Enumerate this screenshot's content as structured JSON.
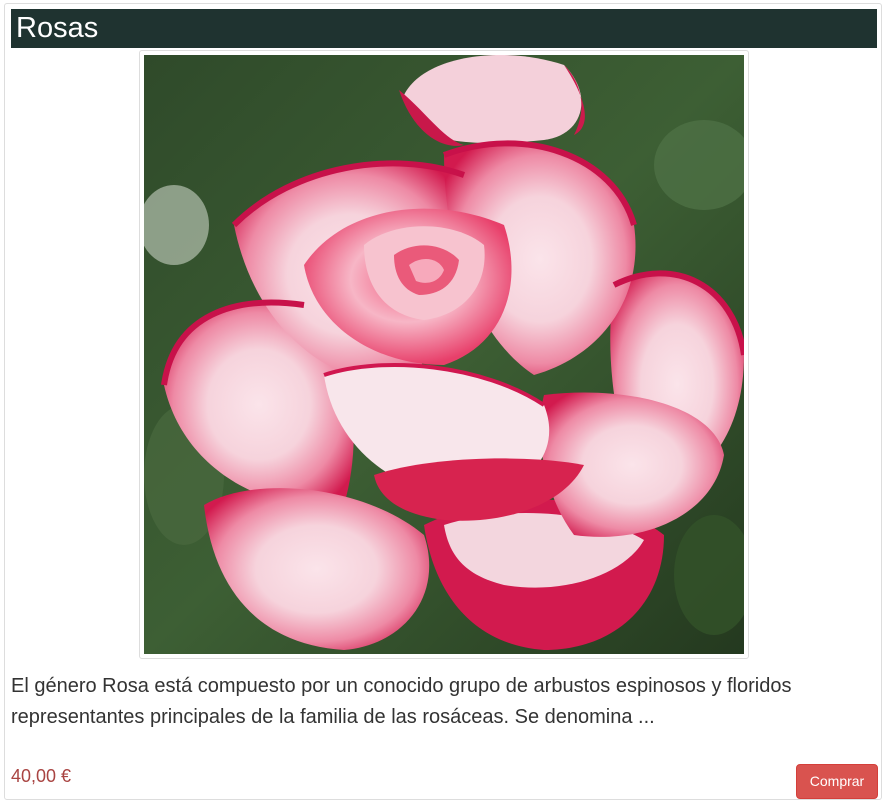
{
  "product": {
    "title": "Rosas",
    "image_alt": "pink and white rose",
    "description": "El género Rosa está compuesto por un conocido grupo de arbustos espinosos y floridos representantes principales de la familia de las rosáceas. Se denomina ...",
    "price": "40,00 €",
    "buy_label": "Comprar"
  },
  "colors": {
    "title_bar": "#1f3330",
    "price": "#a94442",
    "button": "#d9534f"
  }
}
